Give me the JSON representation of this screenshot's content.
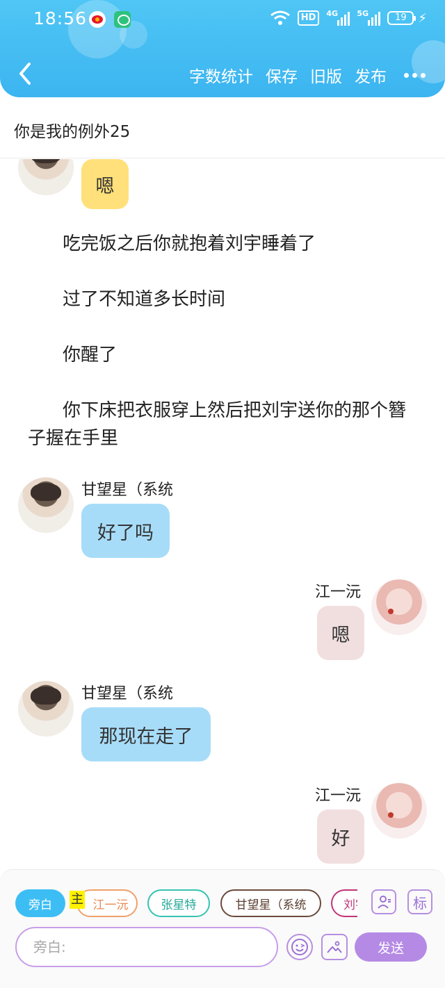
{
  "status_bar": {
    "time": "18:56",
    "network_badge": "HD",
    "signal_1": "4G",
    "signal_2": "5G",
    "battery": "19",
    "apps": [
      "weibo-icon",
      "message-app-icon"
    ]
  },
  "header": {
    "menu": [
      "字数统计",
      "保存",
      "旧版",
      "发布"
    ],
    "accent_color": "#3cb4f0"
  },
  "document": {
    "title": "你是我的例外25"
  },
  "messages": [
    {
      "type": "bubble",
      "side": "left",
      "speaker": "",
      "text": "嗯",
      "color": "#ffe07a"
    },
    {
      "type": "narration",
      "text": "吃完饭之后你就抱着刘宇睡着了"
    },
    {
      "type": "narration",
      "text": "过了不知道多长时间"
    },
    {
      "type": "narration",
      "text": "你醒了"
    },
    {
      "type": "narration",
      "text": "你下床把衣服穿上然后把刘宇送你的那个簪子握在手里"
    },
    {
      "type": "bubble",
      "side": "left",
      "speaker": "甘望星（系统",
      "text": "好了吗",
      "color": "#a7dcf8"
    },
    {
      "type": "bubble",
      "side": "right",
      "speaker": "江一沅",
      "text": "嗯",
      "color": "#f1dfe0"
    },
    {
      "type": "bubble",
      "side": "left",
      "speaker": "甘望星（系统",
      "text": "那现在走了",
      "color": "#a7dcf8"
    },
    {
      "type": "bubble",
      "side": "right",
      "speaker": "江一沅",
      "text": "好",
      "color": "#f1dfe0"
    }
  ],
  "panel": {
    "roles": [
      {
        "label": "旁白",
        "selected": true
      },
      {
        "label": "江一沅",
        "tag": "主"
      },
      {
        "label": "张星特"
      },
      {
        "label": "甘望星（系统"
      },
      {
        "label": "刘宇"
      }
    ],
    "role_button_icon": "role-manage-icon",
    "tag_button_label": "标",
    "input_placeholder": "旁白:",
    "send_label": "发送"
  }
}
